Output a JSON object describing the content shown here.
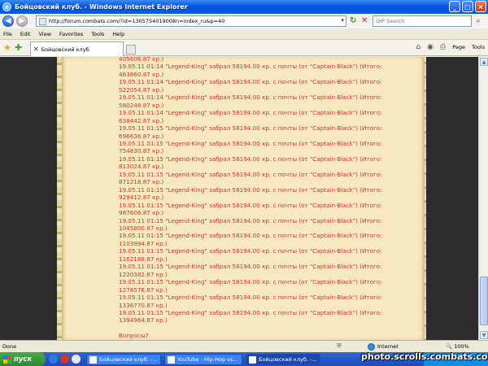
{
  "window": {
    "title": "Бойцовский клуб. - Windows Internet Explorer"
  },
  "address": {
    "url": "http://forum.combats.com/?id=1305754019008n=index_ru&p=40"
  },
  "search": {
    "placeholder": "QIP Search"
  },
  "menu": [
    "File",
    "Edit",
    "View",
    "Favorites",
    "Tools",
    "Help"
  ],
  "tab": {
    "label": "Бойцовский клуб."
  },
  "tools": {
    "page": "Page",
    "tools": "Tools"
  },
  "log": [
    "405606.87 кр.)",
    "19.05.11 01:14 \"Legend-King\" забрал 58194.00 кр. с почты (от \"Captain-Black\") (Итого:",
    "463860.87 кр.)",
    "19.05.11 01:14 \"Legend-King\" забрал 58194.00 кр. с почты (от \"Captain-Black\") (Итого:",
    "522054.87 кр.)",
    "19.05.11 01:14 \"Legend-King\" забрал 58194.00 кр. с почты (от \"Captain-Black\") (Итого:",
    "580248.87 кр.)",
    "19.05.11 01:14 \"Legend-King\" забрал 58194.00 кр. с почты (от \"Captain-Black\") (Итого:",
    "638442.87 кр.)",
    "19.05.11 01:15 \"Legend-King\" забрал 58194.00 кр. с почты (от \"Captain-Black\") (Итого:",
    "696636.87 кр.)",
    "19.05.11 01:15 \"Legend-King\" забрал 58194.00 кр. с почты (от \"Captain-Black\") (Итого:",
    "754830.87 кр.)",
    "19.05.11 01:15 \"Legend-King\" забрал 58194.00 кр. с почты (от \"Captain-Black\") (Итого:",
    "813024.87 кр.)",
    "19.05.11 01:15 \"Legend-King\" забрал 58194.00 кр. с почты (от \"Captain-Black\") (Итого:",
    "871218.87 кр.)",
    "19.05.11 01:15 \"Legend-King\" забрал 58194.00 кр. с почты (от \"Captain-Black\") (Итого:",
    "929412.87 кр.)",
    "19.05.11 01:15 \"Legend-King\" забрал 58194.00 кр. с почты (от \"Captain-Black\") (Итого:",
    "987606.87 кр.)",
    "19.05.11 01:15 \"Legend-King\" забрал 58194.00 кр. с почты (от \"Captain-Black\") (Итого:",
    "1045800.87 кр.)",
    "19.05.11 01:15 \"Legend-King\" забрал 58194.00 кр. с почты (от \"Captain-Black\") (Итого:",
    "1103994.87 кр.)",
    "19.05.11 01:15 \"Legend-King\" забрал 58194.00 кр. с почты (от \"Captain-Black\") (Итого:",
    "1162188.87 кр.)",
    "19.05.11 01:15 \"Legend-King\" забрал 58194.00 кр. с почты (от \"Captain-Black\") (Итого:",
    "1220382.87 кр.)",
    "19.05.11 01:15 \"Legend-King\" забрал 58194.00 кр. с почты (от \"Captain-Black\") (Итого:",
    "1278576.87 кр.)",
    "19.05.11 01:15 \"Legend-King\" забрал 58194.00 кр. с почты (от \"Captain-Black\") (Итого:",
    "1336770.87 кр.)",
    "19.05.11 01:15 \"Legend-King\" забрал 58194.00 кр. с почты (от \"Captain-Black\") (Итого:",
    "1394964.87 кр.)"
  ],
  "question": "Вопросы?",
  "status": {
    "text": "Done",
    "zone": "Internet",
    "zoom": "100%"
  },
  "taskbar": {
    "start": "пуск",
    "tasks": [
      "Бойцовский клуб. -...",
      "YouTube - Hip-Hop vs...",
      "Бойцовский клуб. -..."
    ]
  },
  "watermark": "photo.scrolls.combats.com",
  "icons": {
    "back": "back-arrow-icon",
    "forward": "forward-arrow-icon",
    "refresh": "refresh-icon",
    "stop": "stop-icon",
    "search": "search-icon",
    "favorites": "star-icon",
    "add_favorite": "add-favorite-icon"
  },
  "colors": {
    "log_text": "#c8382a",
    "parchment": "#f7e8c0",
    "titlebar": "#0450d8"
  }
}
